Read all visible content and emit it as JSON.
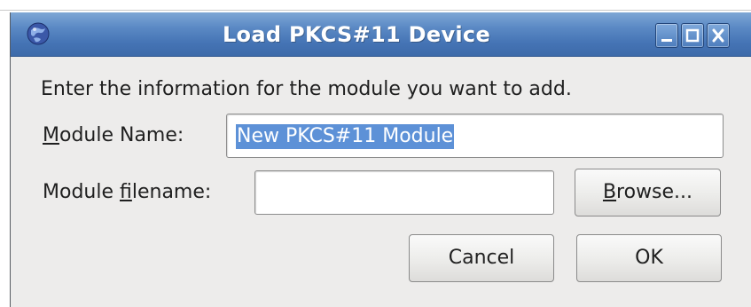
{
  "window": {
    "title": "Load PKCS#11 Device",
    "app_icon": "globe-icon",
    "controls": {
      "minimize_icon": "minimize-icon",
      "maximize_icon": "maximize-icon",
      "close_icon": "close-icon"
    },
    "colors": {
      "titlebar": "#4a7abb",
      "dialog_bg": "#edeceb",
      "selection": "#5d91d7"
    }
  },
  "dialog": {
    "instructions": "Enter the information for the module you want to add.",
    "module_name": {
      "label_mnemonic": "M",
      "label_rest": "odule Name:",
      "value": "New PKCS#11 Module"
    },
    "module_filename": {
      "label_prefix": "Module ",
      "label_mnemonic": "f",
      "label_rest": "ilename:",
      "value": ""
    },
    "buttons": {
      "browse_mnemonic": "B",
      "browse_rest": "rowse...",
      "cancel": "Cancel",
      "ok": "OK"
    }
  }
}
